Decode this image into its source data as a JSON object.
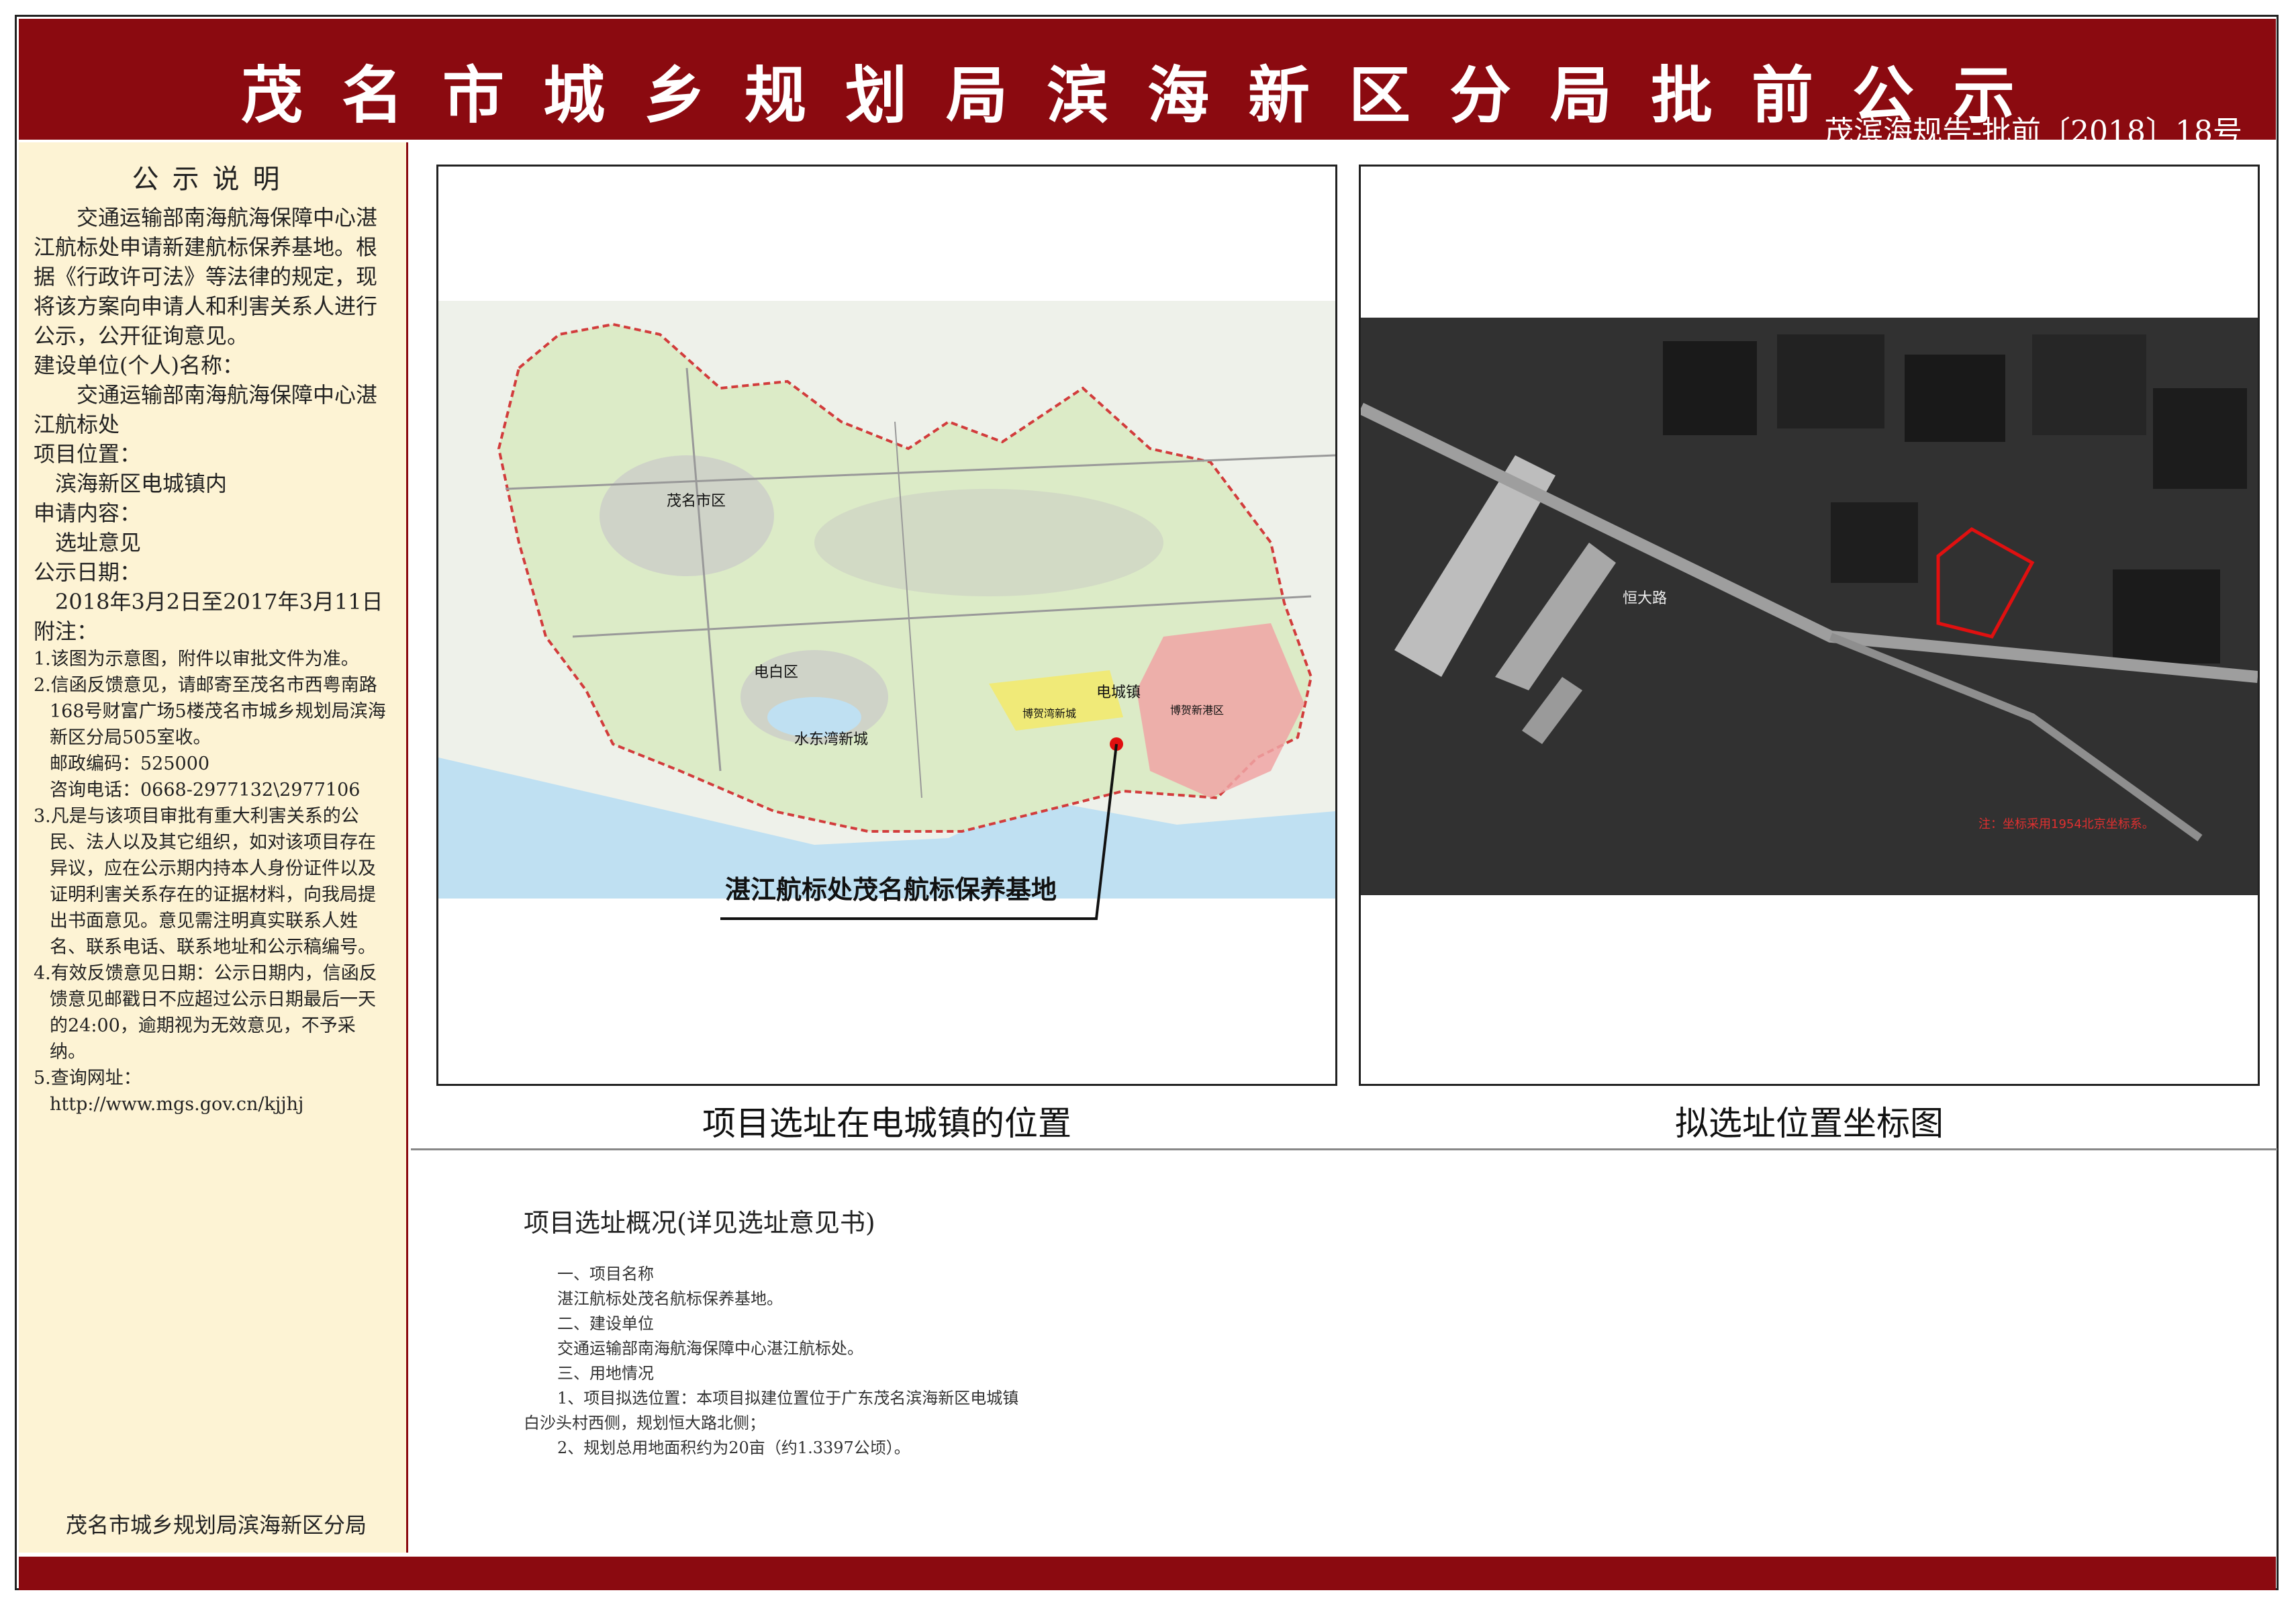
{
  "header": {
    "title": "茂名市城乡规划局滨海新区分局批前公示",
    "doc_no": "茂滨海规告-批前〔2018〕18号"
  },
  "sidebar": {
    "heading": "公示说明",
    "intro": "交通运输部南海航海保障中心湛江航标处申请新建航标保养基地。根据《行政许可法》等法律的规定，现将该方案向申请人和利害关系人进行公示，公开征询意见。",
    "builder_label": "建设单位(个人)名称：",
    "builder_value": "交通运输部南海航海保障中心湛江航标处",
    "location_label": "项目位置：",
    "location_value": "滨海新区电城镇内",
    "apply_label": "申请内容：",
    "apply_value": "选址意见",
    "date_label": "公示日期：",
    "date_value": "2018年3月2日至2017年3月11日",
    "notes_label": "附注：",
    "note1": "1.该图为示意图，附件以审批文件为准。",
    "note2": "2.信函反馈意见，请邮寄至茂名市西粤南路168号财富广场5楼茂名市城乡规划局滨海新区分局505室收。",
    "postcode": "邮政编码：525000",
    "phone": "咨询电话：0668-2977132\\2977106",
    "note3": "3.凡是与该项目审批有重大利害关系的公民、法人以及其它组织，如对该项目存在异议，应在公示期内持本人身份证件以及证明利害关系存在的证据材料，向我局提出书面意见。意见需注明真实联系人姓名、联系电话、联系地址和公示稿编号。",
    "note4": "4.有效反馈意见日期：公示日期内，信函反馈意见邮戳日不应超过公示日期最后一天的24:00，逾期视为无效意见，不予采纳。",
    "note5": "5.查询网址：",
    "url": "http://www.mgs.gov.cn/kjjhj",
    "signature": "茂名市城乡规划局滨海新区分局"
  },
  "map_left": {
    "caption": "项目选址在电城镇的位置",
    "callout": "湛江航标处茂名航标保养基地",
    "labels": {
      "maoming": "茂名市区",
      "dianbai": "电白区",
      "shuidong": "水东湾新城",
      "dianchengzhen": "电城镇",
      "bomao": "博贺湾新城",
      "bohe": "博贺新港区"
    }
  },
  "map_right": {
    "caption": "拟选址位置坐标图",
    "label_road": "恒大路",
    "note": "注：坐标采用1954北京坐标系。"
  },
  "summary": {
    "title": "项目选址概况(详见选址意见书)",
    "lines": [
      "一、项目名称",
      "湛江航标处茂名航标保养基地。",
      "二、建设单位",
      "交通运输部南海航海保障中心湛江航标处。",
      "三、用地情况",
      "1、项目拟选位置：本项目拟建位置位于广东茂名滨海新区电城镇",
      "白沙头村西侧，规划恒大路北侧；",
      "2、规划总用地面积约为20亩（约1.3397公顷）。"
    ]
  },
  "colors": {
    "brand": "#8b0a10",
    "sidebar_bg": "#fdf3d4"
  }
}
